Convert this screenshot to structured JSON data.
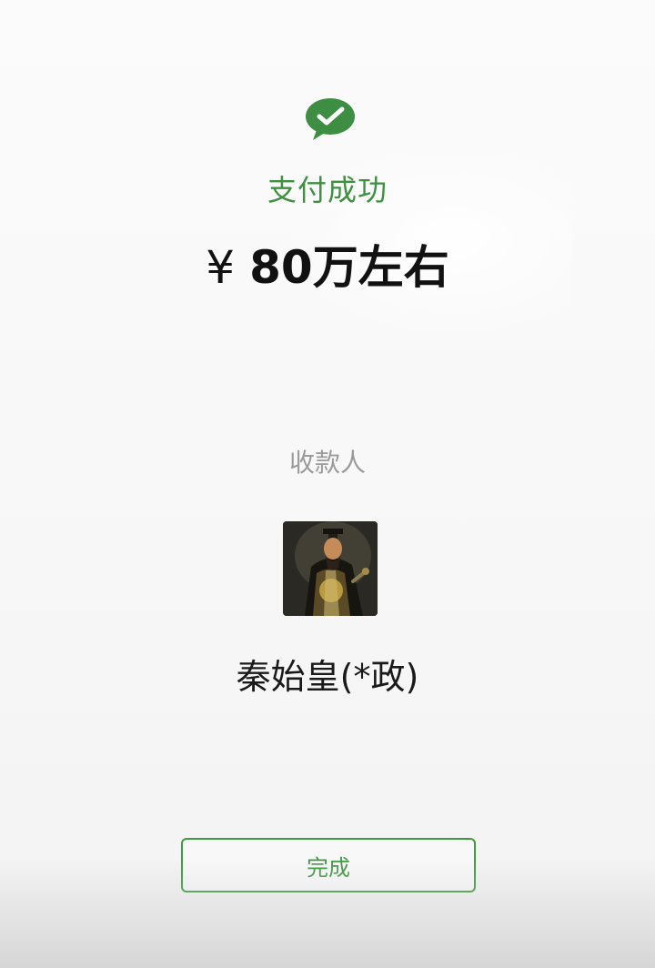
{
  "status": {
    "icon": "wechat-pay-check-icon",
    "title": "支付成功",
    "color": "#3e9140"
  },
  "payment": {
    "currency_symbol": "¥",
    "amount_text": "80万左右"
  },
  "payee": {
    "label": "收款人",
    "avatar": "emperor-portrait",
    "name": "秦始皇(*政)"
  },
  "actions": {
    "done_label": "完成",
    "accent_color": "#3f9a41"
  }
}
